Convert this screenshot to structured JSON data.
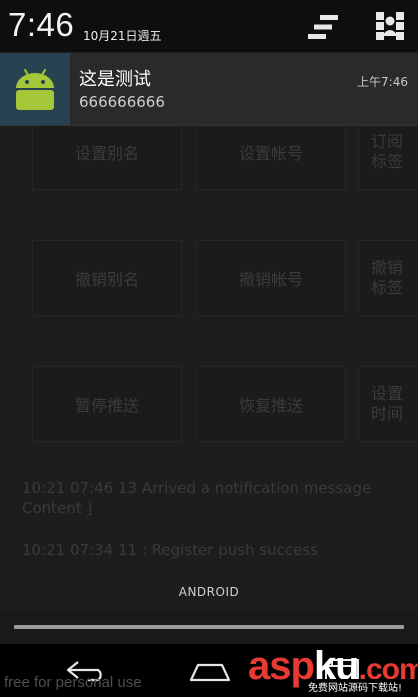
{
  "status_bar": {
    "time": "7:46",
    "date": "10月21日週五"
  },
  "notification": {
    "title": "这是测试",
    "text": "666666666",
    "time": "上午7:46"
  },
  "app_background": {
    "buttons_row1": [
      "设置别名",
      "设置帐号",
      "订阅\n标签"
    ],
    "buttons_row2": [
      "撤销别名",
      "撤销帐号",
      "撤销\n标签"
    ],
    "buttons_row3": [
      "暂停推送",
      "恢复推送",
      "设置\n时间"
    ],
    "log_lines": [
      "10:21 07:46 13 Arrived a notification message\nContent ]",
      "10:21 07:34 11 : Register push success"
    ]
  },
  "shade": {
    "carrier": "ANDROID"
  },
  "watermark": {
    "left_text": "free for personal use",
    "brand_asp": "asp",
    "brand_ku": "ku",
    "brand_dot": ".com",
    "brand_sub": "免费网站源码下载站!"
  },
  "colors": {
    "notification_bg": "#2a2a2a",
    "icon_box_bg": "#274250",
    "android_green": "#a4c639",
    "brand_red": "#e83a32"
  },
  "icons": {
    "clear_all": "clear-all-icon",
    "settings": "quick-settings-icon",
    "app": "android-robot-icon",
    "back": "back-icon",
    "home": "home-icon",
    "recents": "recents-icon"
  }
}
